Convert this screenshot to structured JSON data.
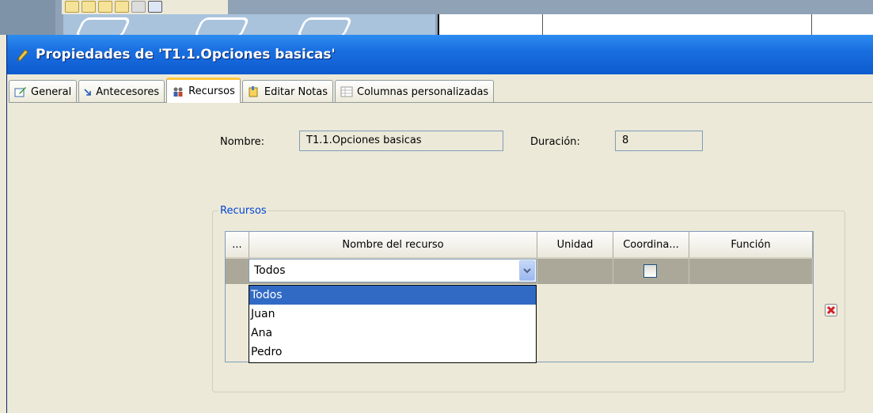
{
  "window": {
    "title": "Propiedades de 'T1.1.Opciones basicas'"
  },
  "tabs": [
    {
      "label": "General",
      "icon": "edit-icon"
    },
    {
      "label": "Antecesores",
      "icon": "arrow-icon"
    },
    {
      "label": "Recursos",
      "icon": "people-icon",
      "active": true
    },
    {
      "label": "Editar Notas",
      "icon": "notes-icon"
    },
    {
      "label": "Columnas personalizadas",
      "icon": "table-icon"
    }
  ],
  "form": {
    "name_label": "Nombre:",
    "name_value": "T1.1.Opciones basicas",
    "duration_label": "Duración:",
    "duration_value": "8"
  },
  "resources": {
    "group_label": "Recursos",
    "columns": [
      "...",
      "Nombre del recurso",
      "Unidad",
      "Coordina...",
      "Función"
    ],
    "row": {
      "resource_value": "Todos",
      "coordinator_checked": false
    },
    "dropdown_options": [
      "Todos",
      "Juan",
      "Ana",
      "Pedro"
    ],
    "selected_option": "Todos"
  },
  "colors": {
    "title_bar": "#0d5bd0",
    "selection": "#316ac5",
    "group_legend": "#0046d5"
  }
}
